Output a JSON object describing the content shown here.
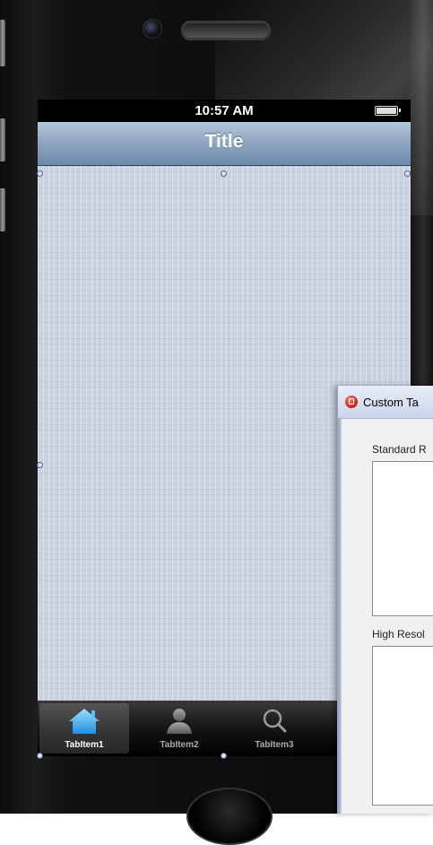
{
  "status_bar": {
    "time": "10:57 AM"
  },
  "nav_bar": {
    "title": "Title"
  },
  "tab_bar": {
    "items": [
      {
        "label": "TabItem1",
        "icon": "home-icon",
        "selected": true
      },
      {
        "label": "TabItem2",
        "icon": "person-icon",
        "selected": false
      },
      {
        "label": "TabItem3",
        "icon": "search-icon",
        "selected": false
      }
    ]
  },
  "dialog": {
    "title": "Custom Ta",
    "standard_label": "Standard R",
    "high_res_label": "High Resol"
  },
  "colors": {
    "nav_bar_gradient": [
      "#b4c6da",
      "#6d89a9"
    ],
    "content_background": "#cbd2df",
    "tab_bar_background": "#151515",
    "selected_tab_icon": "#3aa3f0",
    "handle_border": "#4c5a9a"
  }
}
